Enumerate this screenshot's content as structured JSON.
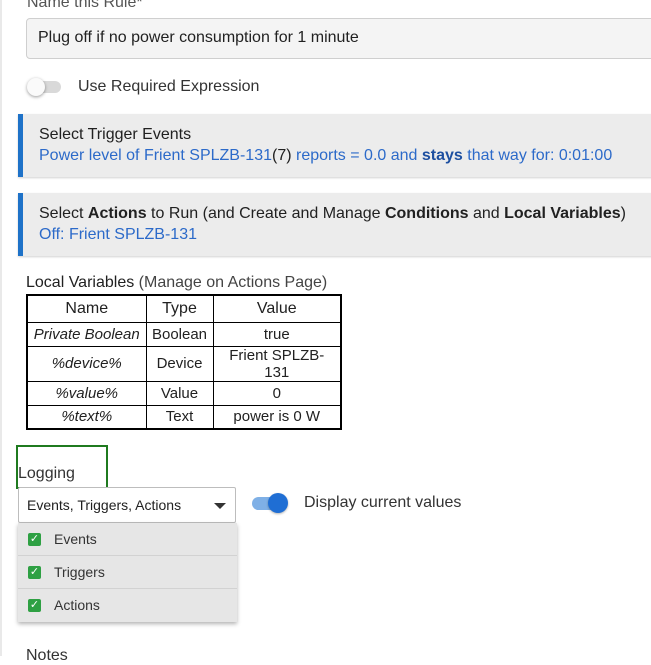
{
  "rule_name": {
    "label": "Name this Rule*",
    "value": "Plug off if no power consumption for 1 minute"
  },
  "required_expression": {
    "label": "Use Required Expression",
    "enabled": false
  },
  "trigger_section": {
    "title": "Select Trigger Events",
    "link_prefix": "Power level of Frient SPLZB-131",
    "link_paren_open": "(",
    "link_number": "7",
    "link_paren_close": ")",
    "link_mid": " reports = 0.0 and ",
    "link_bold": "stays",
    "link_suffix": " that way for: 0:01:00"
  },
  "actions_section": {
    "title_parts": [
      "Select ",
      "Actions",
      " to Run (and Create and Manage ",
      "Conditions",
      " and ",
      "Local Variables",
      ")"
    ],
    "link": "Off: Frient SPLZB-131"
  },
  "local_variables": {
    "title": "Local Variables",
    "subtitle": "(Manage on Actions Page)",
    "columns": [
      "Name",
      "Type",
      "Value"
    ],
    "rows": [
      [
        "Private Boolean",
        "Boolean",
        "true"
      ],
      [
        "%device%",
        "Device",
        "Frient SPLZB-131"
      ],
      [
        "%value%",
        "Value",
        "0"
      ],
      [
        "%text%",
        "Text",
        "power is 0 W"
      ]
    ]
  },
  "logging": {
    "label": "Logging",
    "selected": "Events, Triggers, Actions",
    "options": [
      {
        "label": "Events",
        "checked": true
      },
      {
        "label": "Triggers",
        "checked": true
      },
      {
        "label": "Actions",
        "checked": true
      }
    ]
  },
  "display_current_values": {
    "label": "Display current values",
    "enabled": true
  },
  "notes": {
    "label": "Notes"
  },
  "colors": {
    "accent_blue": "#1e72c8",
    "link_blue": "#2c6ac9",
    "highlight_green": "#1f7a1f",
    "checkbox_green": "#2ea043"
  }
}
